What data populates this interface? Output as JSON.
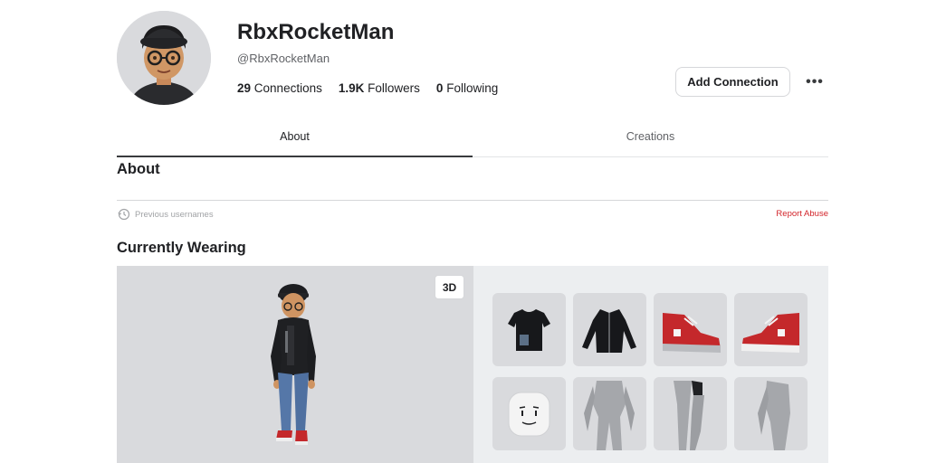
{
  "profile": {
    "display_name": "RbxRocketMan",
    "handle": "@RbxRocketMan",
    "stats": {
      "connections_count": "29",
      "connections_label": "Connections",
      "followers_count": "1.9K",
      "followers_label": "Followers",
      "following_count": "0",
      "following_label": "Following"
    },
    "add_connection_label": "Add Connection",
    "more_label": "•••"
  },
  "tabs": [
    {
      "label": "About",
      "active": true
    },
    {
      "label": "Creations",
      "active": false
    }
  ],
  "about": {
    "title": "About",
    "previous_usernames_label": "Previous usernames",
    "report_abuse_label": "Report Abuse"
  },
  "wearing": {
    "title": "Currently Wearing",
    "view_toggle_label": "3D",
    "items": [
      {
        "name": "shirt-icon"
      },
      {
        "name": "jacket-icon"
      },
      {
        "name": "shoe-left-icon"
      },
      {
        "name": "shoe-right-icon"
      },
      {
        "name": "face-icon"
      },
      {
        "name": "torso-icon"
      },
      {
        "name": "legs-icon"
      },
      {
        "name": "arm-icon"
      }
    ]
  },
  "colors": {
    "accent_red": "#d2242a",
    "panel_gray": "#d9dadd",
    "text_dark": "#202124"
  }
}
